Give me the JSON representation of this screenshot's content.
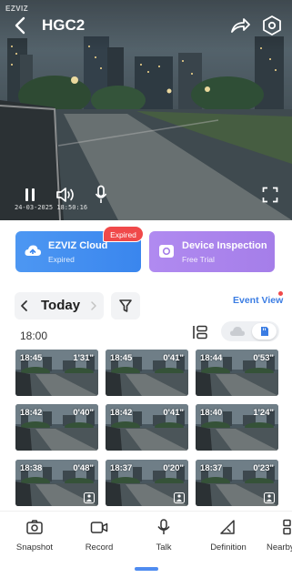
{
  "video": {
    "watermark": "EZVIZ",
    "camera_name": "HGC2",
    "timestamp": "24-03-2025  18:50:16"
  },
  "cards": {
    "cloud": {
      "title": "EZVIZ Cloud",
      "subtitle": "Expired",
      "badge": "Expired"
    },
    "inspection": {
      "title": "Device Inspection",
      "subtitle": "Free Trial"
    }
  },
  "date_nav": {
    "label": "Today",
    "event_view": "Event View"
  },
  "timeline": {
    "hour_header": "18:00"
  },
  "clips": [
    {
      "time": "18:45",
      "duration": "1'31\""
    },
    {
      "time": "18:45",
      "duration": "0'41\""
    },
    {
      "time": "18:44",
      "duration": "0'53\""
    },
    {
      "time": "18:42",
      "duration": "0'40\""
    },
    {
      "time": "18:42",
      "duration": "0'41\""
    },
    {
      "time": "18:40",
      "duration": "1'24\""
    },
    {
      "time": "18:38",
      "duration": "0'48\""
    },
    {
      "time": "18:37",
      "duration": "0'20\""
    },
    {
      "time": "18:37",
      "duration": "0'23\""
    }
  ],
  "toolbar": {
    "snapshot": "Snapshot",
    "record": "Record",
    "talk": "Talk",
    "definition": "Definition",
    "nearby": "Nearby"
  },
  "colors": {
    "accent_blue": "#3b7de3",
    "cloud_card": "#4d97f2",
    "inspection_card": "#a57ee9",
    "badge_red": "#f0494a"
  }
}
